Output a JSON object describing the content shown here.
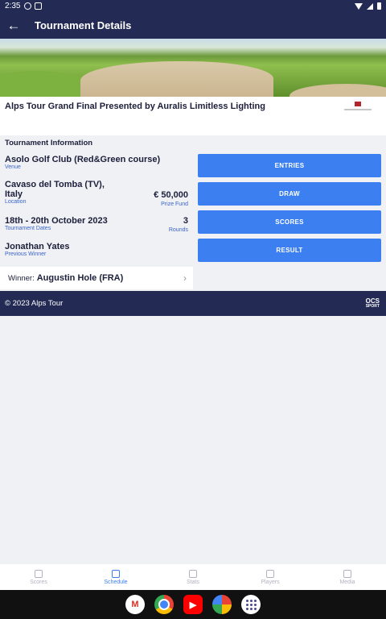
{
  "status": {
    "time": "2:35"
  },
  "appbar": {
    "back_icon": "arrow-left-icon",
    "title": "Tournament Details"
  },
  "tournament": {
    "name": "Alps Tour Grand Final Presented by Auralis Limitless Lighting"
  },
  "info": {
    "heading": "Tournament Information",
    "venue": {
      "value": "Asolo Golf Club (Red&Green course)",
      "label": "Venue"
    },
    "location": {
      "value_line1": "Cavaso del Tomba (TV),",
      "value_line2": "Italy",
      "label": "Location"
    },
    "prize": {
      "value": "€ 50,000",
      "label": "Prize Fund"
    },
    "dates": {
      "value": "18th - 20th October 2023",
      "label": "Tournament Dates"
    },
    "rounds": {
      "value": "3",
      "label": "Rounds"
    },
    "previous": {
      "value": "Jonathan Yates",
      "label": "Previous Winner"
    }
  },
  "winner": {
    "label": "Winner:",
    "name": "Augustin Hole (FRA)"
  },
  "buttons": {
    "entries": "ENTRIES",
    "draw": "DRAW",
    "scores": "SCORES",
    "result": "RESULT"
  },
  "footer": {
    "copyright": "© 2023 Alps Tour",
    "brand_top": "OCS",
    "brand_bottom": "SPORT"
  },
  "bottom_nav": [
    {
      "label": "Scores",
      "icon": "home-icon",
      "active": false
    },
    {
      "label": "Schedule",
      "icon": "calendar-icon",
      "active": true
    },
    {
      "label": "Stats",
      "icon": "bar-chart-icon",
      "active": false
    },
    {
      "label": "Players",
      "icon": "people-icon",
      "active": false
    },
    {
      "label": "Media",
      "icon": "globe-icon",
      "active": false
    }
  ],
  "colors": {
    "primary": "#232b55",
    "accent": "#3b7ff0",
    "label": "#3a63c9"
  }
}
